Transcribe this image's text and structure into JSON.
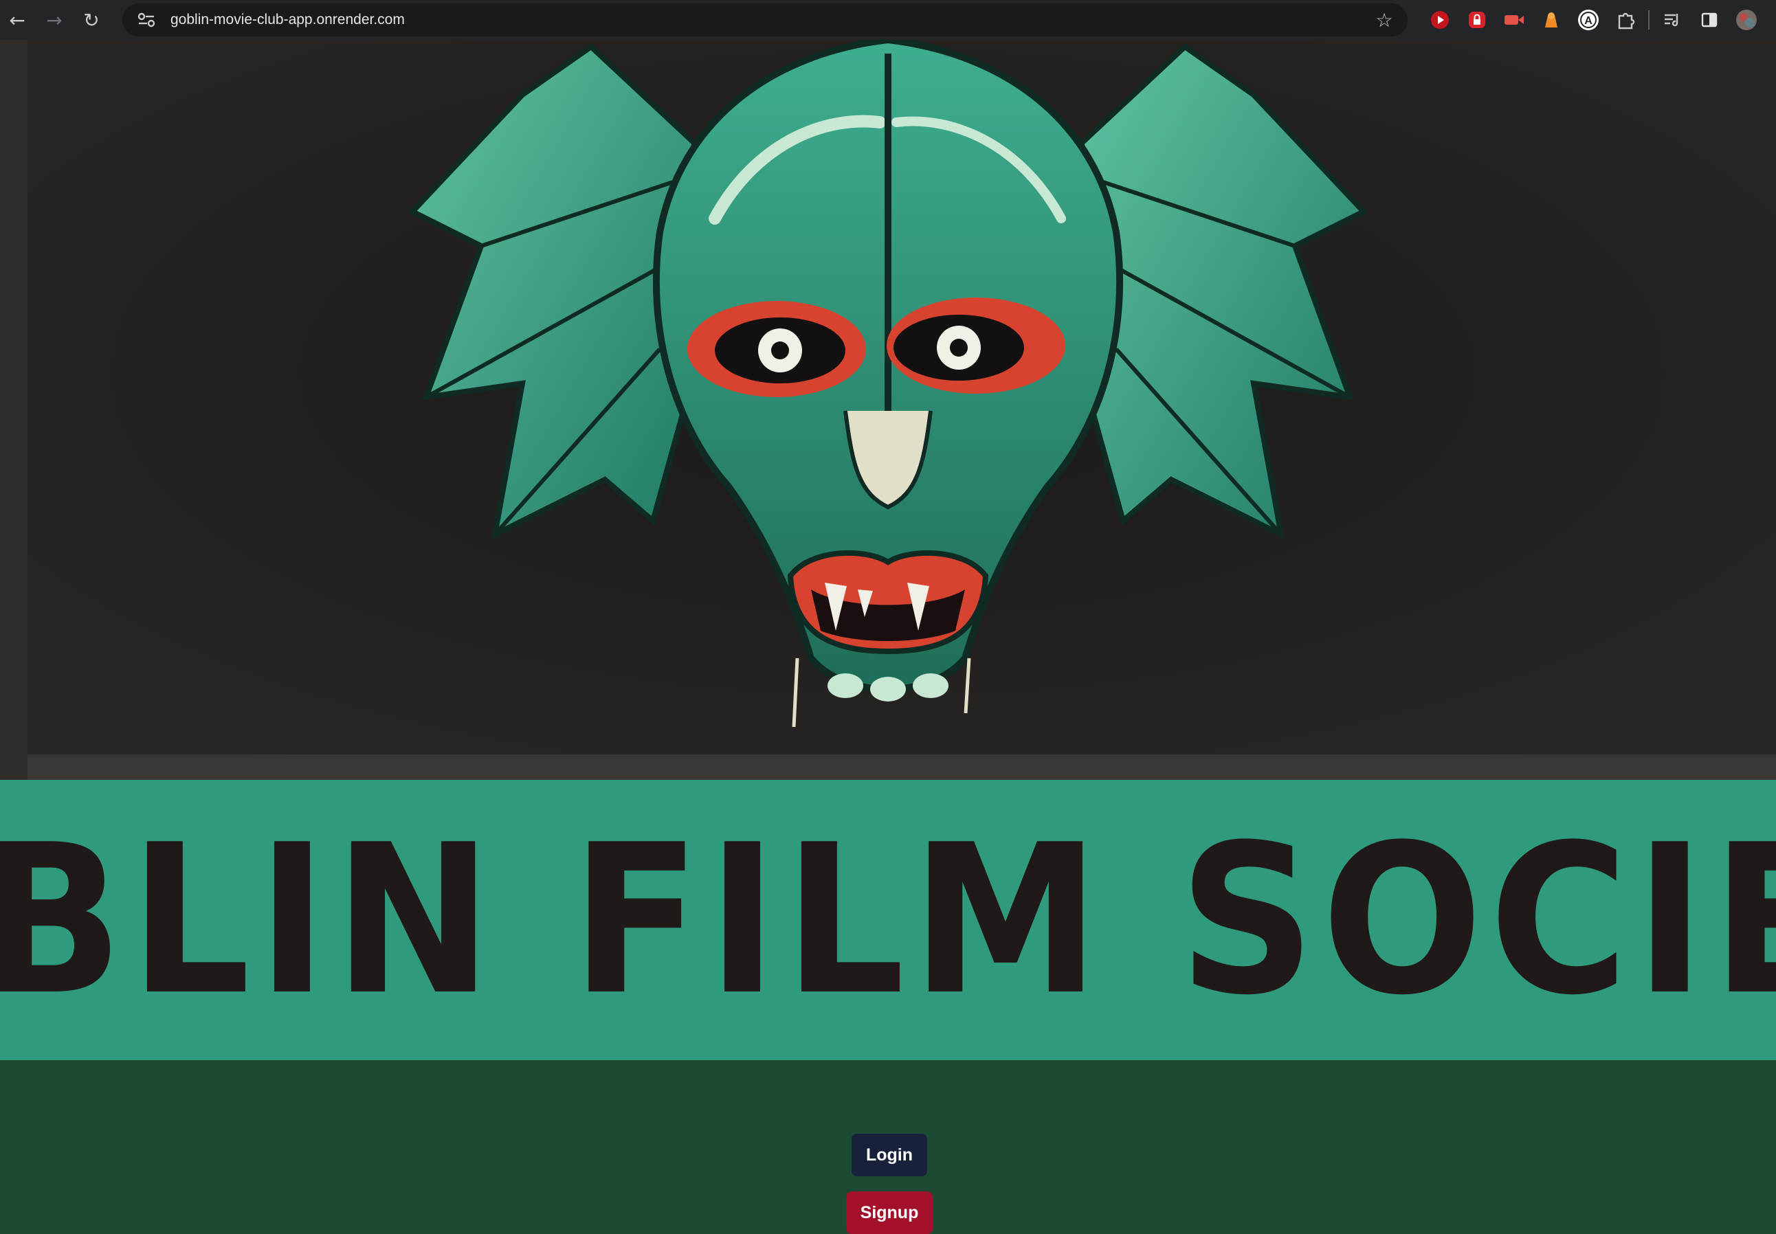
{
  "browser": {
    "url": "goblin-movie-club-app.onrender.com",
    "back_icon": "arrow-left-icon",
    "forward_icon": "arrow-right-icon",
    "reload_icon": "reload-icon",
    "site_info_icon": "tune-icon",
    "bookmark_icon": "star-icon",
    "extensions": [
      "youtube-extension-icon",
      "lock-extension-icon",
      "video-extension-icon",
      "fox-extension-icon",
      "a-circle-extension-icon",
      "puzzle-icon",
      "reading-list-icon",
      "side-panel-icon",
      "profile-avatar"
    ]
  },
  "hero": {
    "image_description_icon": "bat-goblin-illustration",
    "colors": {
      "background": "#221e1c",
      "creature": "#2f9a7c",
      "eyes": "#d8432f"
    }
  },
  "banner": {
    "title": "GOBLIN FILM SOCIETY",
    "colors": {
      "background": "#2f9a7c",
      "text": "#1f1a18"
    }
  },
  "auth": {
    "login_label": "Login",
    "signup_label": "Signup",
    "colors": {
      "area_background": "#1c4a32",
      "login_button": "#17213b",
      "signup_button": "#a3102a"
    }
  }
}
